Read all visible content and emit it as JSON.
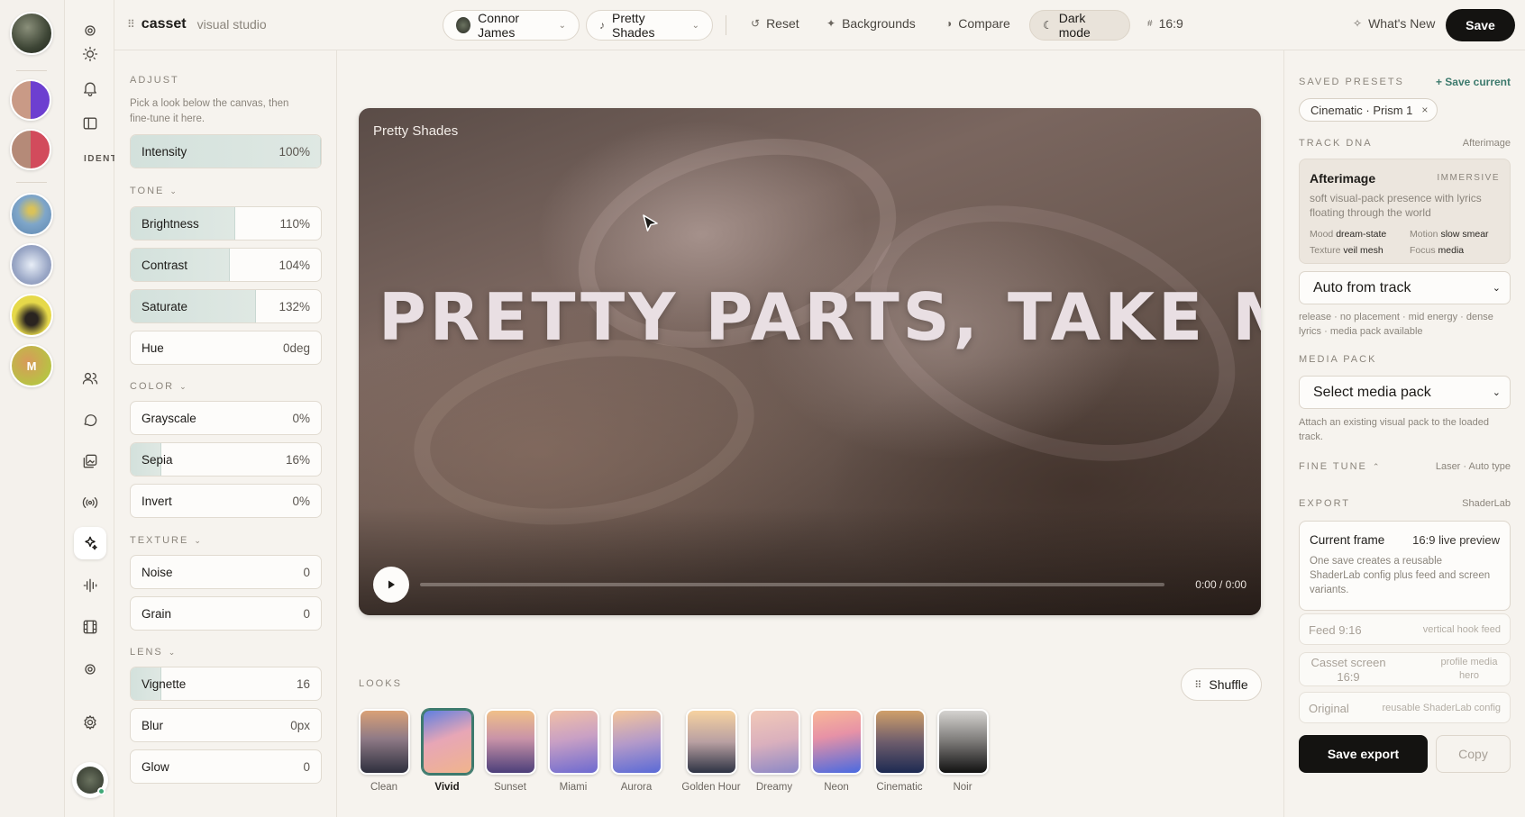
{
  "app": {
    "name": "casset",
    "subtitle": "visual studio"
  },
  "rail": {
    "initial": "M"
  },
  "icon_column": {
    "section_label": "IDENT"
  },
  "topbar": {
    "artist": "Connor James",
    "track": "Pretty Shades",
    "reset": "Reset",
    "backgrounds": "Backgrounds",
    "compare": "Compare",
    "dark_mode": "Dark mode",
    "aspect": "16:9",
    "whats_new": "What's New",
    "save": "Save"
  },
  "adjust": {
    "title": "ADJUST",
    "hint": "Pick a look below the canvas, then fine-tune it here.",
    "intensity": {
      "label": "Intensity",
      "value": "100%",
      "level": 1.0
    },
    "tone": {
      "title": "TONE",
      "brightness": {
        "label": "Brightness",
        "value": "110%",
        "level": 0.55
      },
      "contrast": {
        "label": "Contrast",
        "value": "104%",
        "level": 0.52
      },
      "saturate": {
        "label": "Saturate",
        "value": "132%",
        "level": 0.66
      },
      "hue": {
        "label": "Hue",
        "value": "0deg",
        "level": 0
      }
    },
    "color": {
      "title": "COLOR",
      "grayscale": {
        "label": "Grayscale",
        "value": "0%",
        "level": 0
      },
      "sepia": {
        "label": "Sepia",
        "value": "16%",
        "level": 0.16
      },
      "invert": {
        "label": "Invert",
        "value": "0%",
        "level": 0
      }
    },
    "texture": {
      "title": "TEXTURE",
      "noise": {
        "label": "Noise",
        "value": "0",
        "level": 0
      },
      "grain": {
        "label": "Grain",
        "value": "0",
        "level": 0
      }
    },
    "lens": {
      "title": "LENS",
      "vignette": {
        "label": "Vignette",
        "value": "16",
        "level": 0.16
      },
      "blur": {
        "label": "Blur",
        "value": "0px",
        "level": 0
      },
      "glow": {
        "label": "Glow",
        "value": "0",
        "level": 0
      }
    }
  },
  "canvas": {
    "title": "Pretty Shades",
    "lyric": "PRETTY PARTS, TAKE ME",
    "time": "0:00 / 0:00",
    "progress": 0
  },
  "looks": {
    "title": "LOOKS",
    "shuffle": "Shuffle",
    "items": [
      {
        "name": "Clean",
        "selected": false
      },
      {
        "name": "Vivid",
        "selected": true
      },
      {
        "name": "Sunset",
        "selected": false
      },
      {
        "name": "Miami",
        "selected": false
      },
      {
        "name": "Aurora",
        "selected": false
      },
      {
        "name": "Golden Hour",
        "selected": false
      },
      {
        "name": "Dreamy",
        "selected": false
      },
      {
        "name": "Neon",
        "selected": false
      },
      {
        "name": "Cinematic",
        "selected": false
      },
      {
        "name": "Noir",
        "selected": false
      }
    ]
  },
  "right": {
    "saved_presets": {
      "title": "SAVED PRESETS",
      "action": "+ Save current",
      "chip": "Cinematic · Prism 1"
    },
    "track_dna": {
      "title": "TRACK DNA",
      "meta": "Afterimage",
      "card_title": "Afterimage",
      "tag": "IMMERSIVE",
      "desc": "soft visual-pack presence with lyrics floating through the world",
      "mood_k": "Mood",
      "mood_v": "dream-state",
      "motion_k": "Motion",
      "motion_v": "slow smear",
      "texture_k": "Texture",
      "texture_v": "veil mesh",
      "focus_k": "Focus",
      "focus_v": "media"
    },
    "auto_select": "Auto from track",
    "auto_note": "release · no placement · mid energy · dense lyrics · media pack available",
    "media_pack": {
      "title": "MEDIA PACK",
      "select": "Select media pack",
      "note": "Attach an existing visual pack to the loaded track."
    },
    "fine_tune": {
      "title": "FINE TUNE",
      "meta": "Laser · Auto type"
    },
    "export": {
      "title": "EXPORT",
      "meta": "ShaderLab",
      "card_title": "Current frame",
      "card_meta": "16:9 live preview",
      "card_desc": "One save creates a reusable ShaderLab config plus feed and screen variants.",
      "variants": [
        {
          "a": "Feed 9:16",
          "b": "vertical hook feed"
        },
        {
          "a": "Casset screen 16:9",
          "b": "profile media hero"
        },
        {
          "a": "Original",
          "b": "reusable ShaderLab config"
        }
      ],
      "save": "Save export",
      "copy": "Copy"
    }
  },
  "colors": {
    "accent": "#3d7a6d",
    "primary_button": "#141311",
    "slider_fill": "#d3e1dc"
  }
}
